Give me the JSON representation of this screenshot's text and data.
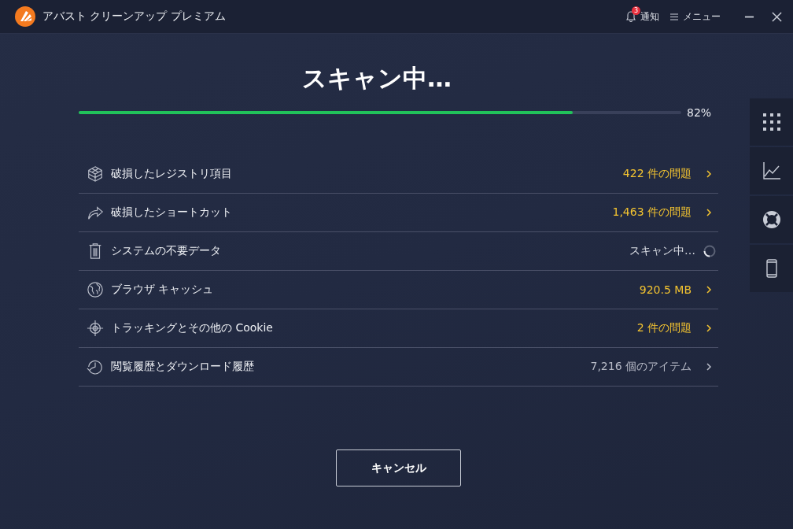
{
  "window": {
    "title": "アバスト クリーンアップ プレミアム",
    "notifications": {
      "count": "3",
      "label": "通知"
    },
    "menu": {
      "label": "メニュー"
    }
  },
  "scan": {
    "title": "スキャン中…",
    "level": 0.82,
    "percent": "82%"
  },
  "rows": [
    {
      "label": "破損したレジストリ項目",
      "kind": "issue",
      "result": "422 件の問題"
    },
    {
      "label": "破損したショートカット",
      "kind": "issue",
      "result": "1,463 件の問題"
    },
    {
      "label": "システムの不要データ",
      "kind": "scanning",
      "result": "スキャン中…"
    },
    {
      "label": "ブラウザ キャッシュ",
      "kind": "issue",
      "result": "920.5 MB"
    },
    {
      "label": "トラッキングとその他の Cookie",
      "kind": "issue",
      "result": "2 件の問題"
    },
    {
      "label": "閲覧履歴とダウンロード履歴",
      "kind": "info",
      "result": "7,216 個のアイテム"
    }
  ],
  "cancel_button": "キャンセル"
}
